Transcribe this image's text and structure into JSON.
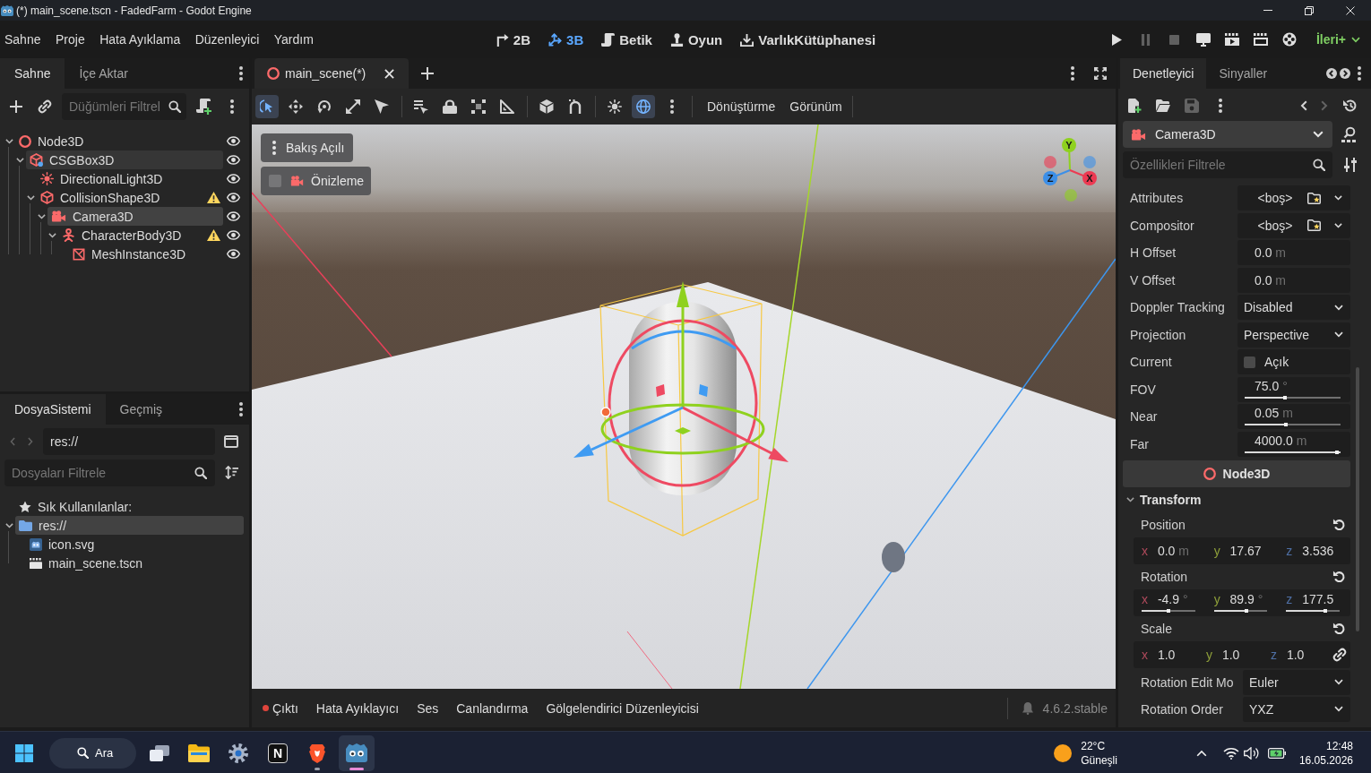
{
  "window": {
    "title": "(*) main_scene.tscn - FadedFarm - Godot Engine"
  },
  "menu_bar": {
    "menus": [
      "Sahne",
      "Proje",
      "Hata Ayıklama",
      "Düzenleyici",
      "Yardım"
    ],
    "workspaces": [
      {
        "kind": "canvas",
        "label": "2B",
        "selected": false
      },
      {
        "kind": "spatial",
        "label": "3B",
        "selected": true
      },
      {
        "kind": "script",
        "label": "Betik",
        "selected": false
      },
      {
        "kind": "game",
        "label": "Oyun",
        "selected": false
      },
      {
        "kind": "assetlib",
        "label": "VarlıkKütüphanesi",
        "selected": false
      }
    ],
    "run_controls": [
      {
        "kind": "play",
        "disabled": false
      },
      {
        "kind": "pause",
        "disabled": true
      },
      {
        "kind": "stop",
        "disabled": true
      },
      {
        "kind": "remote",
        "disabled": false
      },
      {
        "kind": "playscene",
        "disabled": false
      },
      {
        "kind": "playcustom",
        "disabled": false
      },
      {
        "kind": "movie",
        "disabled": false
      }
    ],
    "renderer": "İleri+"
  },
  "scene_dock": {
    "tabs": [
      {
        "label": "Sahne",
        "selected": true
      },
      {
        "label": "İçe Aktar",
        "selected": false
      }
    ],
    "filter": {
      "placeholder": "Düğümleri Filtrel"
    },
    "tree": [
      {
        "name": "Node3D",
        "kind": "node3d",
        "selected": false,
        "hovered": false,
        "warning": false,
        "visible": true,
        "expanded": true,
        "children": [
          {
            "name": "CSGBox3D",
            "kind": "csgbox",
            "selected": false,
            "hovered": true,
            "warning": false,
            "visible": true,
            "expanded": true,
            "children": [
              {
                "name": "DirectionalLight3D",
                "kind": "light",
                "selected": false,
                "hovered": false,
                "warning": false,
                "visible": true
              },
              {
                "name": "CollisionShape3D",
                "kind": "collision",
                "selected": false,
                "hovered": false,
                "warning": true,
                "visible": true,
                "expanded": true,
                "children": [
                  {
                    "name": "Camera3D",
                    "kind": "camera",
                    "selected": true,
                    "hovered": false,
                    "warning": false,
                    "visible": true,
                    "expanded": true,
                    "children": [
                      {
                        "name": "CharacterBody3D",
                        "kind": "character",
                        "selected": false,
                        "hovered": false,
                        "warning": true,
                        "visible": true,
                        "expanded": true,
                        "children": [
                          {
                            "name": "MeshInstance3D",
                            "kind": "mesh",
                            "selected": false,
                            "hovered": false,
                            "warning": false,
                            "visible": true
                          }
                        ]
                      }
                    ]
                  }
                ]
              }
            ]
          }
        ]
      }
    ]
  },
  "filesystem_dock": {
    "tabs": [
      {
        "label": "DosyaSistemi",
        "selected": true
      },
      {
        "label": "Geçmiş",
        "selected": false
      }
    ],
    "nav": [
      {
        "kind": "back",
        "disabled": true
      },
      {
        "kind": "forward",
        "disabled": true
      }
    ],
    "path": {
      "value": "res://"
    },
    "filter": {
      "placeholder": "Dosyaları Filtrele"
    },
    "favorites": "Sık Kullanılanlar:",
    "tree": [
      {
        "name": "res://",
        "kind": "folder",
        "selected": true,
        "expanded": true,
        "children": [
          {
            "name": "icon.svg",
            "kind": "image",
            "selected": false
          },
          {
            "name": "main_scene.tscn",
            "kind": "scene",
            "selected": false
          }
        ]
      }
    ]
  },
  "editor": {
    "scene_tabs": [
      {
        "label": "main_scene(*)",
        "selected": true
      }
    ],
    "tool_groups": [
      [
        {
          "kind": "select",
          "selected": true
        },
        {
          "kind": "move",
          "selected": false
        },
        {
          "kind": "rotate",
          "selected": false
        },
        {
          "kind": "scale",
          "selected": false
        },
        {
          "kind": "pointer",
          "selected": false
        }
      ],
      [
        {
          "kind": "list",
          "selected": false
        },
        {
          "kind": "lock",
          "selected": false
        },
        {
          "kind": "group",
          "selected": false
        },
        {
          "kind": "ruler",
          "selected": false
        }
      ],
      [
        {
          "kind": "local",
          "selected": false
        },
        {
          "kind": "snap",
          "selected": false
        }
      ],
      [
        {
          "kind": "sun",
          "selected": false
        },
        {
          "kind": "environment",
          "selected": true
        }
      ]
    ],
    "menus": [
      "Dönüştürme",
      "Görünüm"
    ],
    "viewport": {
      "perspective_menu": "Bakış Açılı",
      "preview": {
        "label": "Önizleme",
        "checked": false
      },
      "gizmo_axes": [
        {
          "label": "Y",
          "color": "#8fd11e"
        },
        {
          "label": "Z",
          "color": "#3c8fe8"
        },
        {
          "label": "X",
          "color": "#ec3a52"
        }
      ]
    },
    "bottom_tabs": [
      {
        "label": "Çıktı",
        "unread": true
      },
      {
        "label": "Hata Ayıklayıcı",
        "unread": false
      },
      {
        "label": "Ses",
        "unread": false
      },
      {
        "label": "Canlandırma",
        "unread": false
      },
      {
        "label": "Gölgelendirici Düzenleyicisi",
        "unread": false
      }
    ],
    "version": "4.6.2.stable"
  },
  "inspector": {
    "tabs": [
      {
        "label": "Denetleyici",
        "selected": true
      },
      {
        "label": "Sinyaller",
        "selected": false
      }
    ],
    "toolbar": [
      {
        "kind": "new",
        "disabled": false
      },
      {
        "kind": "open",
        "disabled": false
      },
      {
        "kind": "save",
        "disabled": true
      }
    ],
    "history": [
      {
        "kind": "back",
        "disabled": false
      },
      {
        "kind": "forward",
        "disabled": true
      }
    ],
    "object": {
      "name": "Camera3D",
      "kind": "camera"
    },
    "filter": {
      "placeholder": "Özellikleri Filtrele"
    },
    "properties": [
      {
        "label": "Attributes",
        "kind": "resource",
        "value": "<boş>"
      },
      {
        "label": "Compositor",
        "kind": "resource",
        "value": "<boş>"
      },
      {
        "label": "H Offset",
        "kind": "number",
        "value": "0.0",
        "unit": "m"
      },
      {
        "label": "V Offset",
        "kind": "number",
        "value": "0.0",
        "unit": "m"
      },
      {
        "label": "Doppler Tracking",
        "kind": "enum",
        "value": "Disabled"
      },
      {
        "label": "Projection",
        "kind": "enum",
        "value": "Perspective"
      },
      {
        "label": "Current",
        "kind": "check",
        "checked": false,
        "value": "Açık"
      },
      {
        "label": "FOV",
        "kind": "slider",
        "value": "75.0",
        "unit": "°",
        "level": 0.43
      },
      {
        "label": "Near",
        "kind": "slider",
        "value": "0.05",
        "unit": "m",
        "level": 0.44
      },
      {
        "label": "Far",
        "kind": "slider",
        "value": "4000.0",
        "unit": "m",
        "level": 1.0
      }
    ],
    "section": {
      "label": "Node3D",
      "kind": "node3d"
    },
    "groups": [
      {
        "label": "Transform",
        "expanded": true,
        "properties": [
          {
            "label": "Position",
            "kind": "vector",
            "modified": true,
            "components": [
              {
                "axis": "x",
                "value": "0.0",
                "unit": "m"
              },
              {
                "axis": "y",
                "value": "17.67"
              },
              {
                "axis": "z",
                "value": "3.536"
              }
            ]
          },
          {
            "label": "Rotation",
            "kind": "vector",
            "modified": true,
            "components": [
              {
                "axis": "x",
                "value": "-4.9",
                "unit": "°",
                "level": 0.53
              },
              {
                "axis": "y",
                "value": "89.9",
                "unit": "°",
                "level": 0.64
              },
              {
                "axis": "z",
                "value": "177.5",
                "level": 0.77
              }
            ]
          },
          {
            "label": "Scale",
            "kind": "vector",
            "modified": true,
            "linked": true,
            "components": [
              {
                "axis": "x",
                "value": "1.0"
              },
              {
                "axis": "y",
                "value": "1.0"
              },
              {
                "axis": "z",
                "value": "1.0"
              }
            ]
          },
          {
            "label": "Rotation Edit Mo",
            "kind": "enum",
            "value": "Euler"
          },
          {
            "label": "Rotation Order",
            "kind": "enum",
            "value": "YXZ"
          }
        ]
      }
    ]
  },
  "taskbar": {
    "search": {
      "label": "Ara"
    },
    "apps": [
      {
        "kind": "taskview",
        "running": false,
        "active": false
      },
      {
        "kind": "files",
        "running": false,
        "active": false
      },
      {
        "kind": "settings",
        "running": false,
        "active": false
      },
      {
        "kind": "letter",
        "glyph": "N",
        "running": false,
        "active": false
      },
      {
        "kind": "browser",
        "running": true,
        "active": false
      },
      {
        "kind": "godot",
        "running": true,
        "active": true
      }
    ],
    "weather": {
      "temperature": "22°C",
      "condition": "Güneşli"
    },
    "clock": {
      "time": "12:48",
      "date": "16.05.2026"
    }
  }
}
